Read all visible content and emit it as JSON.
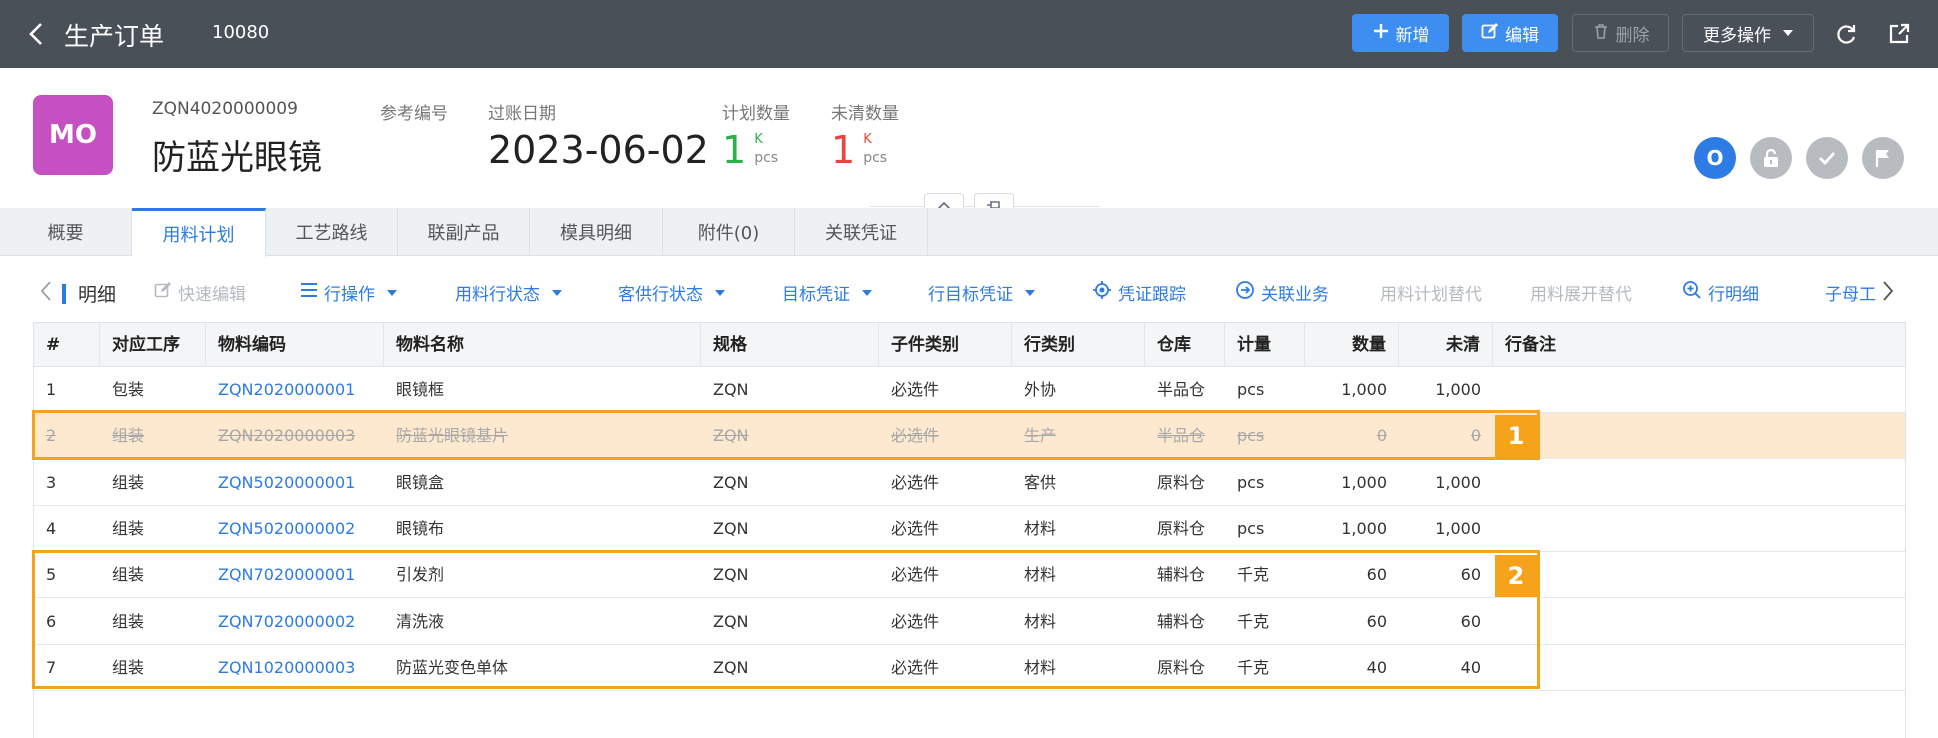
{
  "header": {
    "title": "生产订单",
    "doc_number": "10080",
    "buttons": {
      "new": "新增",
      "edit": "编辑",
      "delete": "删除",
      "more": "更多操作"
    }
  },
  "order": {
    "badge": "MO",
    "code": "ZQN4020000009",
    "name": "防蓝光眼镜",
    "ref_label": "参考编号",
    "posting_date_label": "过账日期",
    "posting_date": "2023-06-02",
    "planned_qty_label": "计划数量",
    "planned_qty": "1",
    "planned_qty_scale": "K",
    "planned_qty_unit": "pcs",
    "open_qty_label": "未清数量",
    "open_qty": "1",
    "open_qty_scale": "K",
    "open_qty_unit": "pcs",
    "status_letter": "O"
  },
  "colors": {
    "topbar": "#4a5058",
    "primary": "#3d8ef0",
    "badge": "#c550c2",
    "planned_qty": "#2bb24c",
    "open_qty": "#e8463c",
    "highlight": "#f5a31a"
  },
  "tabs": [
    "概要",
    "用料计划",
    "工艺路线",
    "联副产品",
    "模具明细",
    "附件(0)",
    "关联凭证"
  ],
  "toolbar": {
    "section": "明细",
    "quick_edit": "快速编辑",
    "row_ops": "行操作",
    "material_row_status": "用料行状态",
    "consign_row_status": "客供行状态",
    "target_voucher": "目标凭证",
    "row_target_voucher": "行目标凭证",
    "voucher_trace": "凭证跟踪",
    "related_business": "关联业务",
    "plan_substitute": "用料计划替代",
    "expand_substitute": "用料展开替代",
    "row_detail": "行明细",
    "sub_parent": "子母工"
  },
  "table": {
    "columns": [
      "#",
      "对应工序",
      "物料编码",
      "物料名称",
      "规格",
      "子件类别",
      "行类别",
      "仓库",
      "计量",
      "数量",
      "未清",
      "行备注"
    ],
    "rows": [
      {
        "no": "1",
        "process": "包装",
        "code": "ZQN2020000001",
        "name": "眼镜框",
        "spec": "ZQN",
        "sub_type": "必选件",
        "row_type": "外协",
        "warehouse": "半品仓",
        "uom": "pcs",
        "qty": "1,000",
        "open": "1,000",
        "note": ""
      },
      {
        "no": "2",
        "process": "组装",
        "code": "ZQN2020000003",
        "name": "防蓝光眼镜基片",
        "spec": "ZQN",
        "sub_type": "必选件",
        "row_type": "生产",
        "warehouse": "半品仓",
        "uom": "pcs",
        "qty": "0",
        "open": "0",
        "note": ""
      },
      {
        "no": "3",
        "process": "组装",
        "code": "ZQN5020000001",
        "name": "眼镜盒",
        "spec": "ZQN",
        "sub_type": "必选件",
        "row_type": "客供",
        "warehouse": "原料仓",
        "uom": "pcs",
        "qty": "1,000",
        "open": "1,000",
        "note": ""
      },
      {
        "no": "4",
        "process": "组装",
        "code": "ZQN5020000002",
        "name": "眼镜布",
        "spec": "ZQN",
        "sub_type": "必选件",
        "row_type": "材料",
        "warehouse": "原料仓",
        "uom": "pcs",
        "qty": "1,000",
        "open": "1,000",
        "note": ""
      },
      {
        "no": "5",
        "process": "组装",
        "code": "ZQN7020000001",
        "name": "引发剂",
        "spec": "ZQN",
        "sub_type": "必选件",
        "row_type": "材料",
        "warehouse": "辅料仓",
        "uom": "千克",
        "qty": "60",
        "open": "60",
        "note": ""
      },
      {
        "no": "6",
        "process": "组装",
        "code": "ZQN7020000002",
        "name": "清洗液",
        "spec": "ZQN",
        "sub_type": "必选件",
        "row_type": "材料",
        "warehouse": "辅料仓",
        "uom": "千克",
        "qty": "60",
        "open": "60",
        "note": ""
      },
      {
        "no": "7",
        "process": "组装",
        "code": "ZQN1020000003",
        "name": "防蓝光变色单体",
        "spec": "ZQN",
        "sub_type": "必选件",
        "row_type": "材料",
        "warehouse": "原料仓",
        "uom": "千克",
        "qty": "40",
        "open": "40",
        "note": ""
      }
    ]
  },
  "annotations": {
    "marker_1": "1",
    "marker_2": "2"
  }
}
